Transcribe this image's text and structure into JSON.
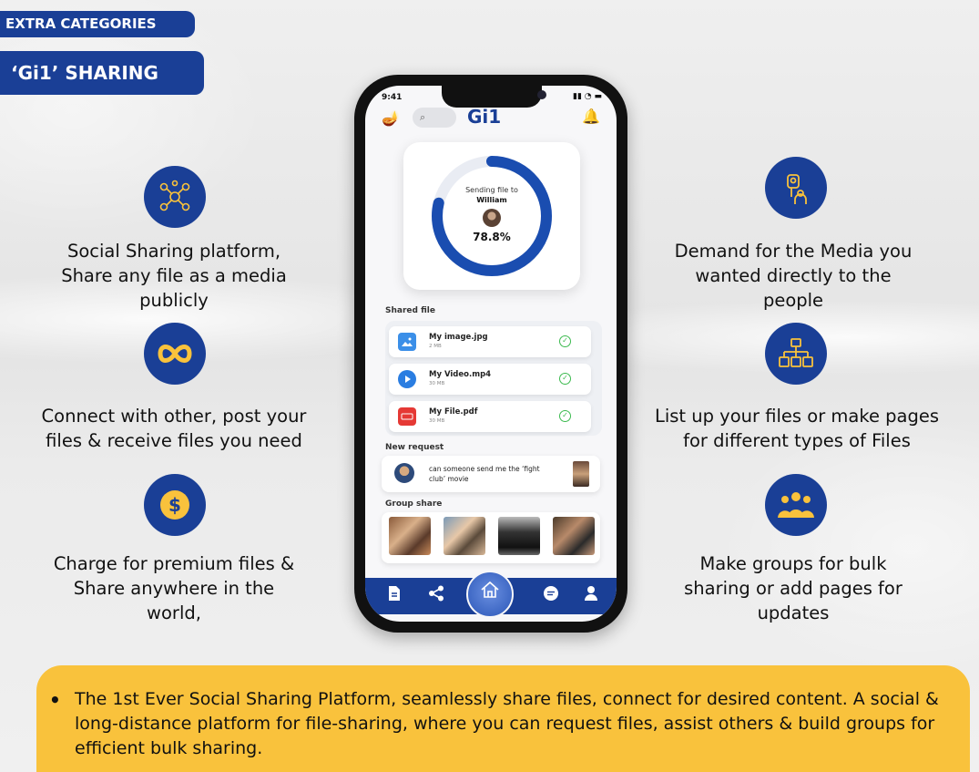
{
  "labels": {
    "extra_categories": "EXTRA CATEGORIES",
    "gi1_sharing": "‘Gi1’ SHARING"
  },
  "features_left": [
    {
      "icon": "network-share-icon",
      "text_lines": [
        "Social Sharing platform,",
        "Share any file as a media",
        "publicly"
      ]
    },
    {
      "icon": "infinity-icon",
      "text_lines": [
        "Connect with other, post your",
        "files & receive files you need"
      ]
    },
    {
      "icon": "dollar-coin-icon",
      "text_lines": [
        "Charge for premium files &",
        "Share anywhere in the",
        "world,"
      ]
    }
  ],
  "features_right": [
    {
      "icon": "media-demand-icon",
      "text_lines": [
        "Demand for the Media you",
        "wanted directly to the",
        "people"
      ]
    },
    {
      "icon": "file-hierarchy-icon",
      "text_lines": [
        "List up your files or make pages",
        "for different types of Files"
      ]
    },
    {
      "icon": "group-people-icon",
      "text_lines": [
        "Make groups for bulk",
        "sharing or add pages for",
        "updates"
      ]
    }
  ],
  "phone": {
    "status_time": "9:41",
    "app_title": "Gi1",
    "sending": {
      "label": "Sending file to",
      "recipient": "William",
      "percent_label": "78.8%",
      "progress": 0.788
    },
    "shared_file_label": "Shared file",
    "files": [
      {
        "name": "My image.jpg",
        "size": "2 MB",
        "type": "image",
        "color": "#3b8fe8"
      },
      {
        "name": "My Video.mp4",
        "size": "30 MB",
        "type": "video",
        "color": "#2a7de1"
      },
      {
        "name": "My File.pdf",
        "size": "30 MB",
        "type": "pdf",
        "color": "#e53935"
      }
    ],
    "new_request_label": "New request",
    "request_text": "can someone send me the ‘fight club’ movie",
    "group_share_label": "Group share"
  },
  "banner": {
    "bullet": "•",
    "text": "The 1st Ever Social Sharing Platform, seamlessly share files, connect for desired content. A social & long-distance platform for file-sharing, where you can request files, assist others & build groups for efficient bulk sharing."
  },
  "colors": {
    "brand_blue": "#1a3f96",
    "accent_yellow": "#f9c23c",
    "success_green": "#3cba4f"
  }
}
